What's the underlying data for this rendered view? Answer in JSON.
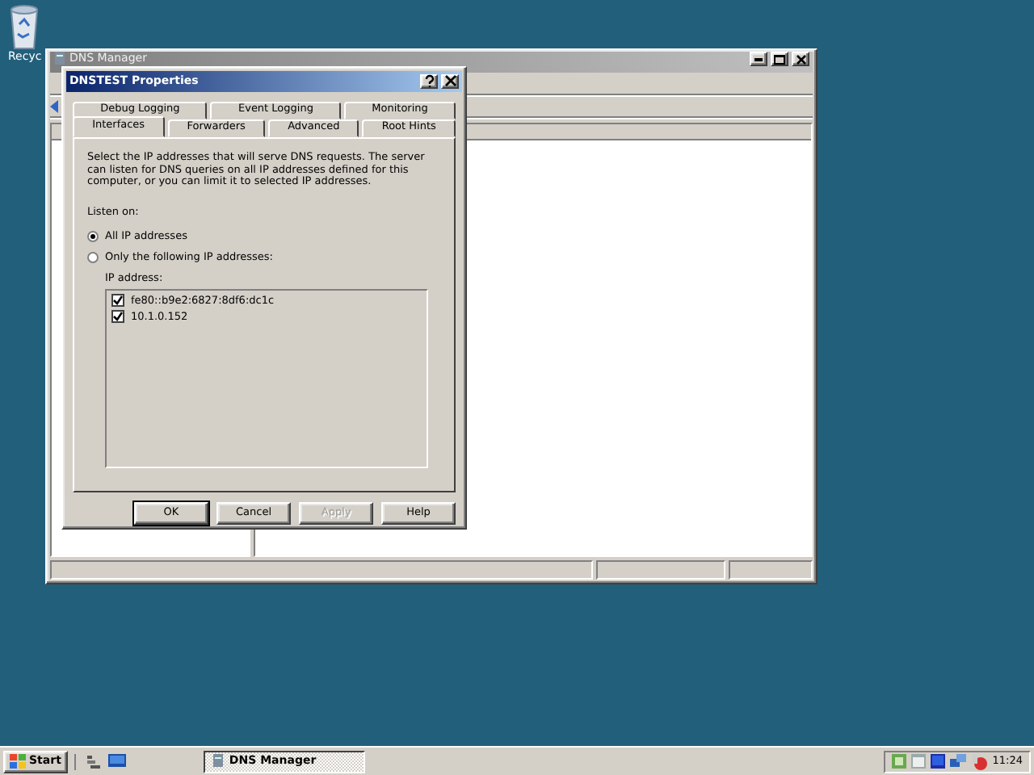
{
  "desktop": {
    "icons": [
      {
        "label": "Recyc"
      }
    ]
  },
  "main_window": {
    "title": "DNS Manager",
    "active": false
  },
  "dialog": {
    "title": "DNSTEST Properties",
    "tab_rows": [
      [
        {
          "label": "Debug Logging",
          "selected": false
        },
        {
          "label": "Event Logging",
          "selected": false
        },
        {
          "label": "Monitoring",
          "selected": false
        }
      ],
      [
        {
          "label": "Interfaces",
          "selected": true
        },
        {
          "label": "Forwarders",
          "selected": false
        },
        {
          "label": "Advanced",
          "selected": false
        },
        {
          "label": "Root Hints",
          "selected": false
        }
      ]
    ],
    "description": "Select the IP addresses that will serve DNS requests. The server can listen for DNS queries on all IP addresses defined for this computer, or you can limit it to selected IP addresses.",
    "listen_on_label": "Listen on:",
    "options": [
      {
        "label": "All IP addresses",
        "selected": true
      },
      {
        "label": "Only the following IP addresses:",
        "selected": false
      }
    ],
    "ip_list_label": "IP address:",
    "ip_addresses": [
      {
        "address": "fe80::b9e2:6827:8df6:dc1c",
        "checked": true
      },
      {
        "address": "10.1.0.152",
        "checked": true
      }
    ],
    "buttons": [
      {
        "label": "OK",
        "disabled": false,
        "default": true
      },
      {
        "label": "Cancel",
        "disabled": false,
        "default": false
      },
      {
        "label": "Apply",
        "disabled": true,
        "default": false
      },
      {
        "label": "Help",
        "disabled": false,
        "default": false
      }
    ]
  },
  "taskbar": {
    "start": "Start",
    "tasks": [
      {
        "label": "DNS Manager",
        "selected": true
      }
    ],
    "clock": "11:24"
  }
}
